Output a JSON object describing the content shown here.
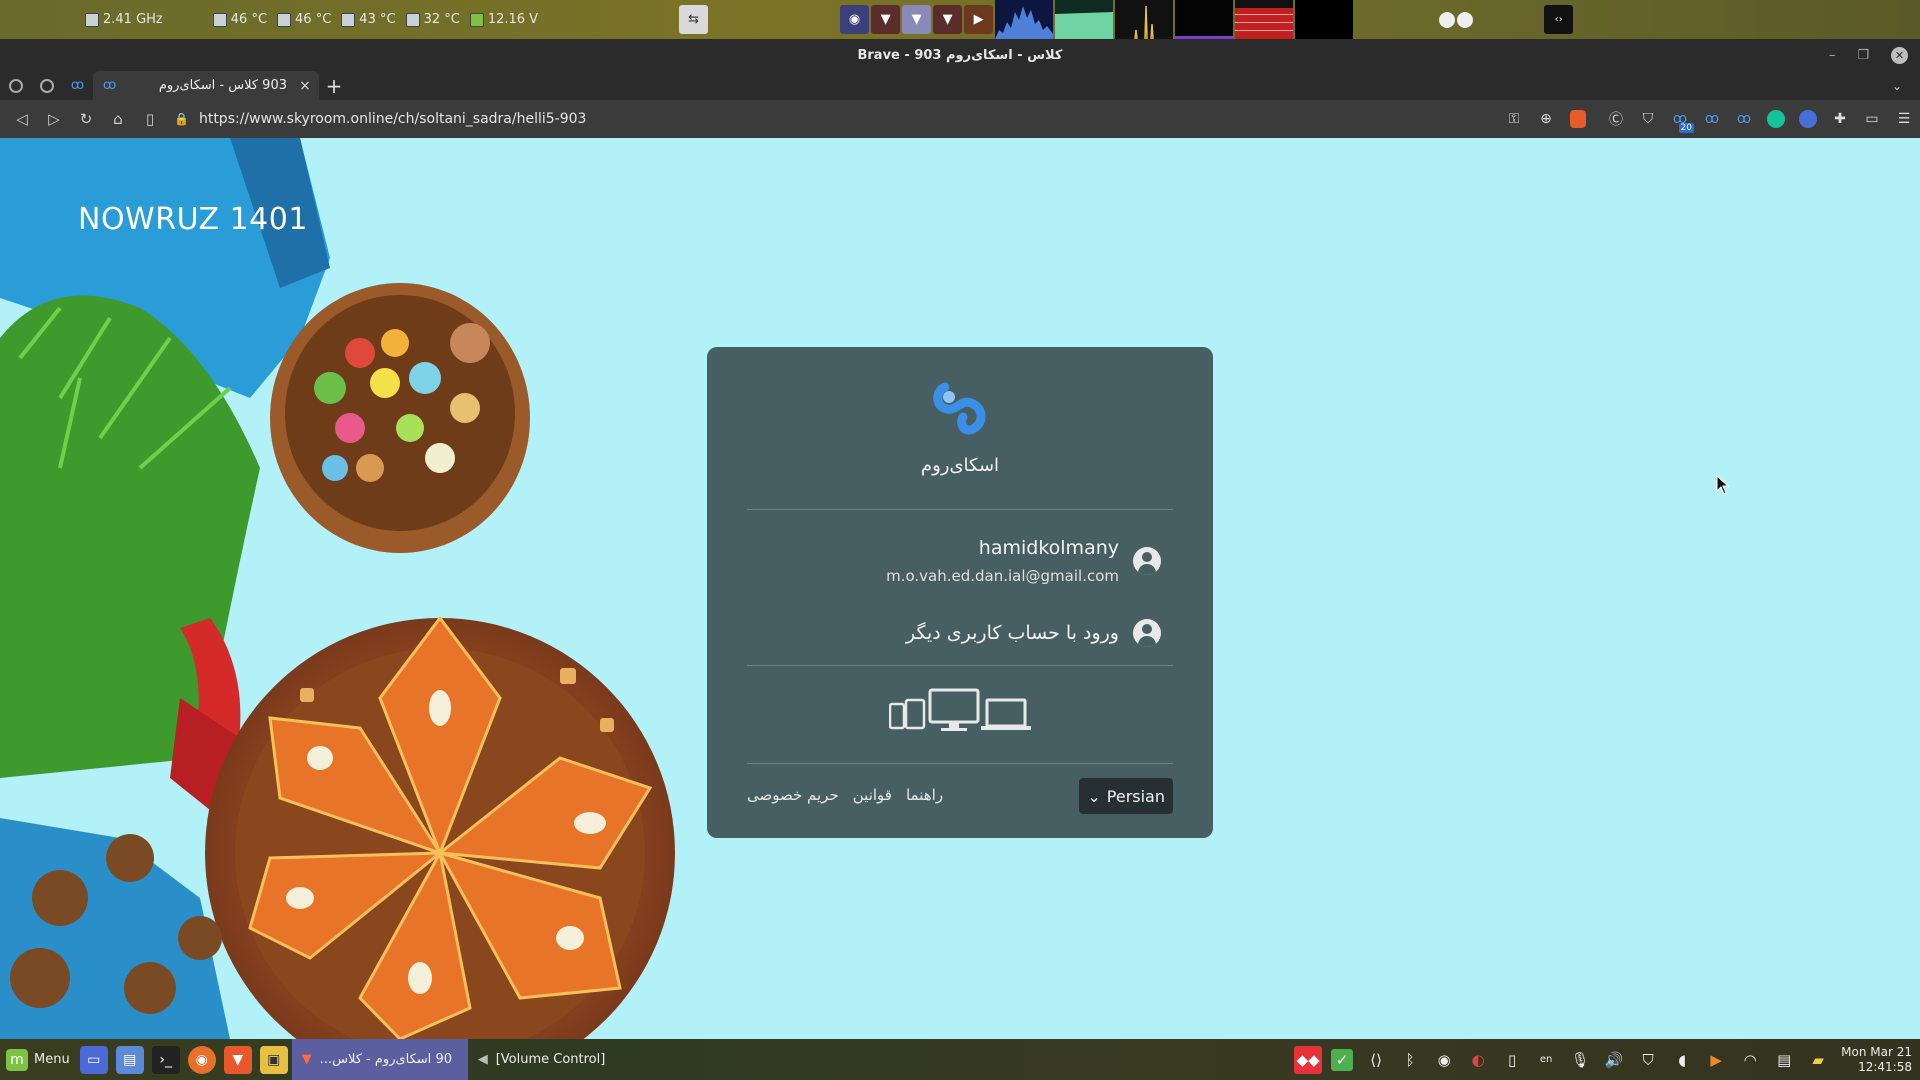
{
  "top_panel": {
    "cpu_freq": "2.41 GHz",
    "temps": [
      "46 °C",
      "46 °C",
      "43 °C",
      "32 °C"
    ],
    "voltage": "12.16 V"
  },
  "window": {
    "title": "Brave - 903 کلاس - اسکای‌روم"
  },
  "tabs": {
    "active_label": "903 کلاس - اسکای‌روم",
    "close": "×",
    "new_tab": "+"
  },
  "toolbar": {
    "url": "https://www.skyroom.online/ch/soltani_sadra/helli5-903",
    "badge_count": "20"
  },
  "page": {
    "hero_title": "NOWRUZ 1401",
    "brand_name": "اسکای‌روم",
    "account": {
      "username": "hamidkolmany",
      "email": "m.o.vah.ed.dan.ial@gmail.com"
    },
    "other_account": "ورود با حساب کاربری دیگر",
    "language": "Persian",
    "footer_links": [
      "راهنما",
      "قوانین",
      "حریم خصوصی"
    ]
  },
  "taskbar": {
    "menu_label": "Menu",
    "active_window": "90 اسکای‌روم - کلاس...",
    "volume_window": "[Volume Control]",
    "keyboard_layout": "en",
    "clock_date": "Mon Mar 21",
    "clock_time": "12:41:58"
  },
  "colors": {
    "page_bg": "#b3f1f8",
    "card_bg": "#475f62",
    "brand_blue": "#3b8fe6",
    "taskbar_active": "#5b5fa0"
  }
}
